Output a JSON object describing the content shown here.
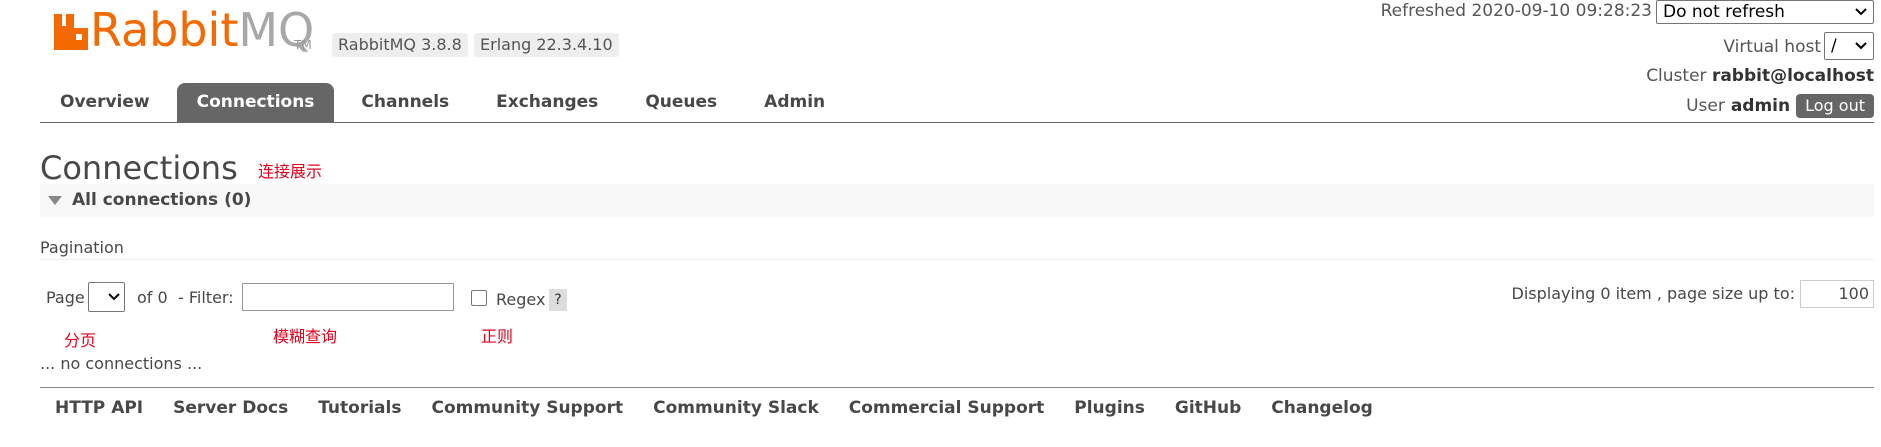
{
  "logo": {
    "rabbit": "Rabbit",
    "mq": "MQ",
    "tm": "TM"
  },
  "versions": {
    "rabbitmq": "RabbitMQ 3.8.8",
    "erlang": "Erlang 22.3.4.10"
  },
  "header": {
    "refreshed": "Refreshed 2020-09-10 09:28:23",
    "refresh_select": "Do not refresh",
    "virtual_host_label": "Virtual host",
    "virtual_host_value": "/",
    "cluster_label": "Cluster",
    "cluster_value": "rabbit@localhost",
    "user_label": "User",
    "user_value": "admin",
    "logout": "Log out"
  },
  "tabs": [
    {
      "label": "Overview",
      "active": false
    },
    {
      "label": "Connections",
      "active": true
    },
    {
      "label": "Channels",
      "active": false
    },
    {
      "label": "Exchanges",
      "active": false
    },
    {
      "label": "Queues",
      "active": false
    },
    {
      "label": "Admin",
      "active": false
    }
  ],
  "page": {
    "title": "Connections",
    "section_title": "All connections (0)",
    "pagination_label": "Pagination",
    "page_label": "Page",
    "of_label": "of 0",
    "filter_label": "- Filter:",
    "filter_value": "",
    "regex_label": "Regex",
    "regex_help": "?",
    "displaying": "Displaying 0 item , page size up to:",
    "page_size": "100",
    "no_connections": "... no connections ..."
  },
  "annotations": {
    "connections": "连接展示",
    "page": "分页",
    "filter": "模糊查询",
    "regex": "正则"
  },
  "footer": [
    "HTTP API",
    "Server Docs",
    "Tutorials",
    "Community Support",
    "Community Slack",
    "Commercial Support",
    "Plugins",
    "GitHub",
    "Changelog"
  ],
  "colors": {
    "brand": "#f46900",
    "logo_grey": "#a8a8a8",
    "tab_active": "#666666",
    "annotation": "#e4001b"
  }
}
